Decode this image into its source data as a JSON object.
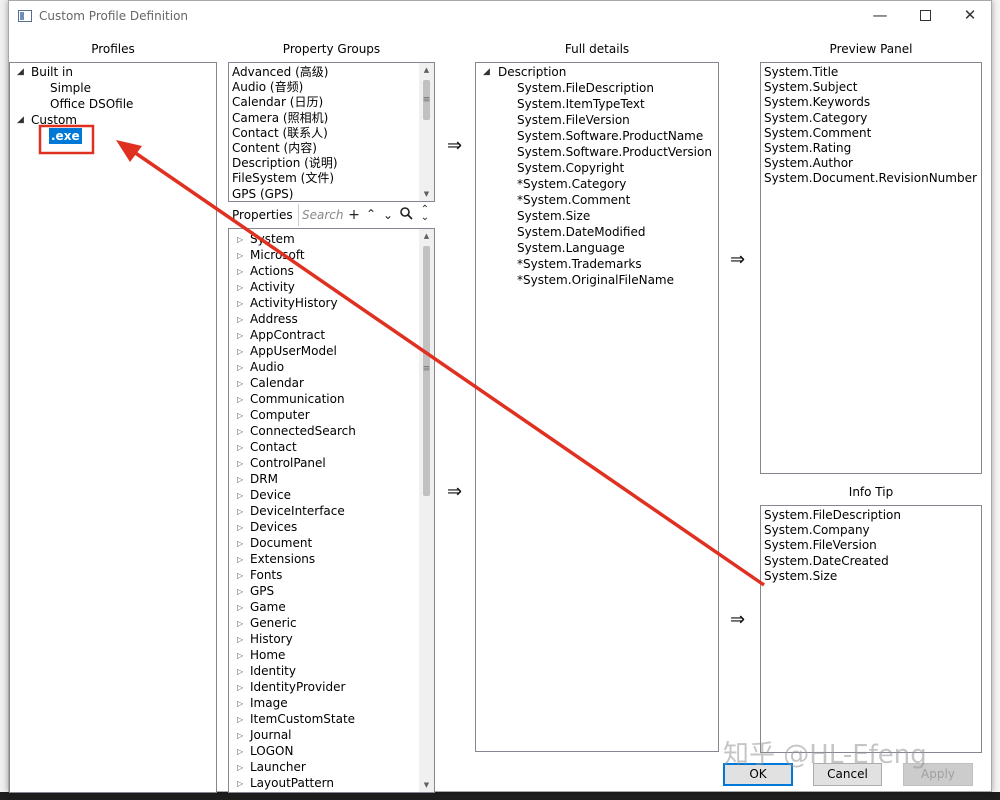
{
  "window": {
    "title": "Custom Profile Definition"
  },
  "panes": {
    "profiles": "Profiles",
    "property_groups": "Property Groups",
    "full_details": "Full details",
    "preview_panel": "Preview Panel",
    "info_tip": "Info Tip"
  },
  "profiles": {
    "builtin_label": "Built in",
    "builtin_items": [
      "Simple",
      "Office DSOfile"
    ],
    "custom_label": "Custom",
    "custom_items": [
      ".exe"
    ]
  },
  "property_groups": [
    "Advanced (高级)",
    "Audio (音频)",
    "Calendar (日历)",
    "Camera (照相机)",
    "Contact (联系人)",
    "Content (内容)",
    "Description (说明)",
    "FileSystem (文件)",
    "GPS (GPS)"
  ],
  "properties": {
    "label": "Properties",
    "search_placeholder": "Search",
    "items": [
      "System",
      "Microsoft",
      "Actions",
      "Activity",
      "ActivityHistory",
      "Address",
      "AppContract",
      "AppUserModel",
      "Audio",
      "Calendar",
      "Communication",
      "Computer",
      "ConnectedSearch",
      "Contact",
      "ControlPanel",
      "DRM",
      "Device",
      "DeviceInterface",
      "Devices",
      "Document",
      "Extensions",
      "Fonts",
      "GPS",
      "Game",
      "Generic",
      "History",
      "Home",
      "Identity",
      "IdentityProvider",
      "Image",
      "ItemCustomState",
      "Journal",
      "LOGON",
      "Launcher",
      "LayoutPattern"
    ]
  },
  "full_details": {
    "group": "Description",
    "items": [
      "System.FileDescription",
      "System.ItemTypeText",
      "System.FileVersion",
      "System.Software.ProductName",
      "System.Software.ProductVersion",
      "System.Copyright",
      "*System.Category",
      "*System.Comment",
      "System.Size",
      "System.DateModified",
      "System.Language",
      "*System.Trademarks",
      "*System.OriginalFileName"
    ]
  },
  "preview_panel": [
    "System.Title",
    "System.Subject",
    "System.Keywords",
    "System.Category",
    "System.Comment",
    "System.Rating",
    "System.Author",
    "System.Document.RevisionNumber"
  ],
  "info_tip": [
    "System.FileDescription",
    "System.Company",
    "System.FileVersion",
    "System.DateCreated",
    "System.Size"
  ],
  "arrows": {
    "symbol": "⇒"
  },
  "buttons": {
    "ok": "OK",
    "cancel": "Cancel",
    "apply": "Apply"
  },
  "watermark": "知乎 @HL-Efeng",
  "colors": {
    "selection": "#0078d7",
    "annotation": "#e03020"
  },
  "icons": {
    "add": "plus-icon",
    "up": "chevron-up-icon",
    "down": "chevron-down-icon",
    "search": "search-icon",
    "sort": "expand-collapse-icon"
  }
}
